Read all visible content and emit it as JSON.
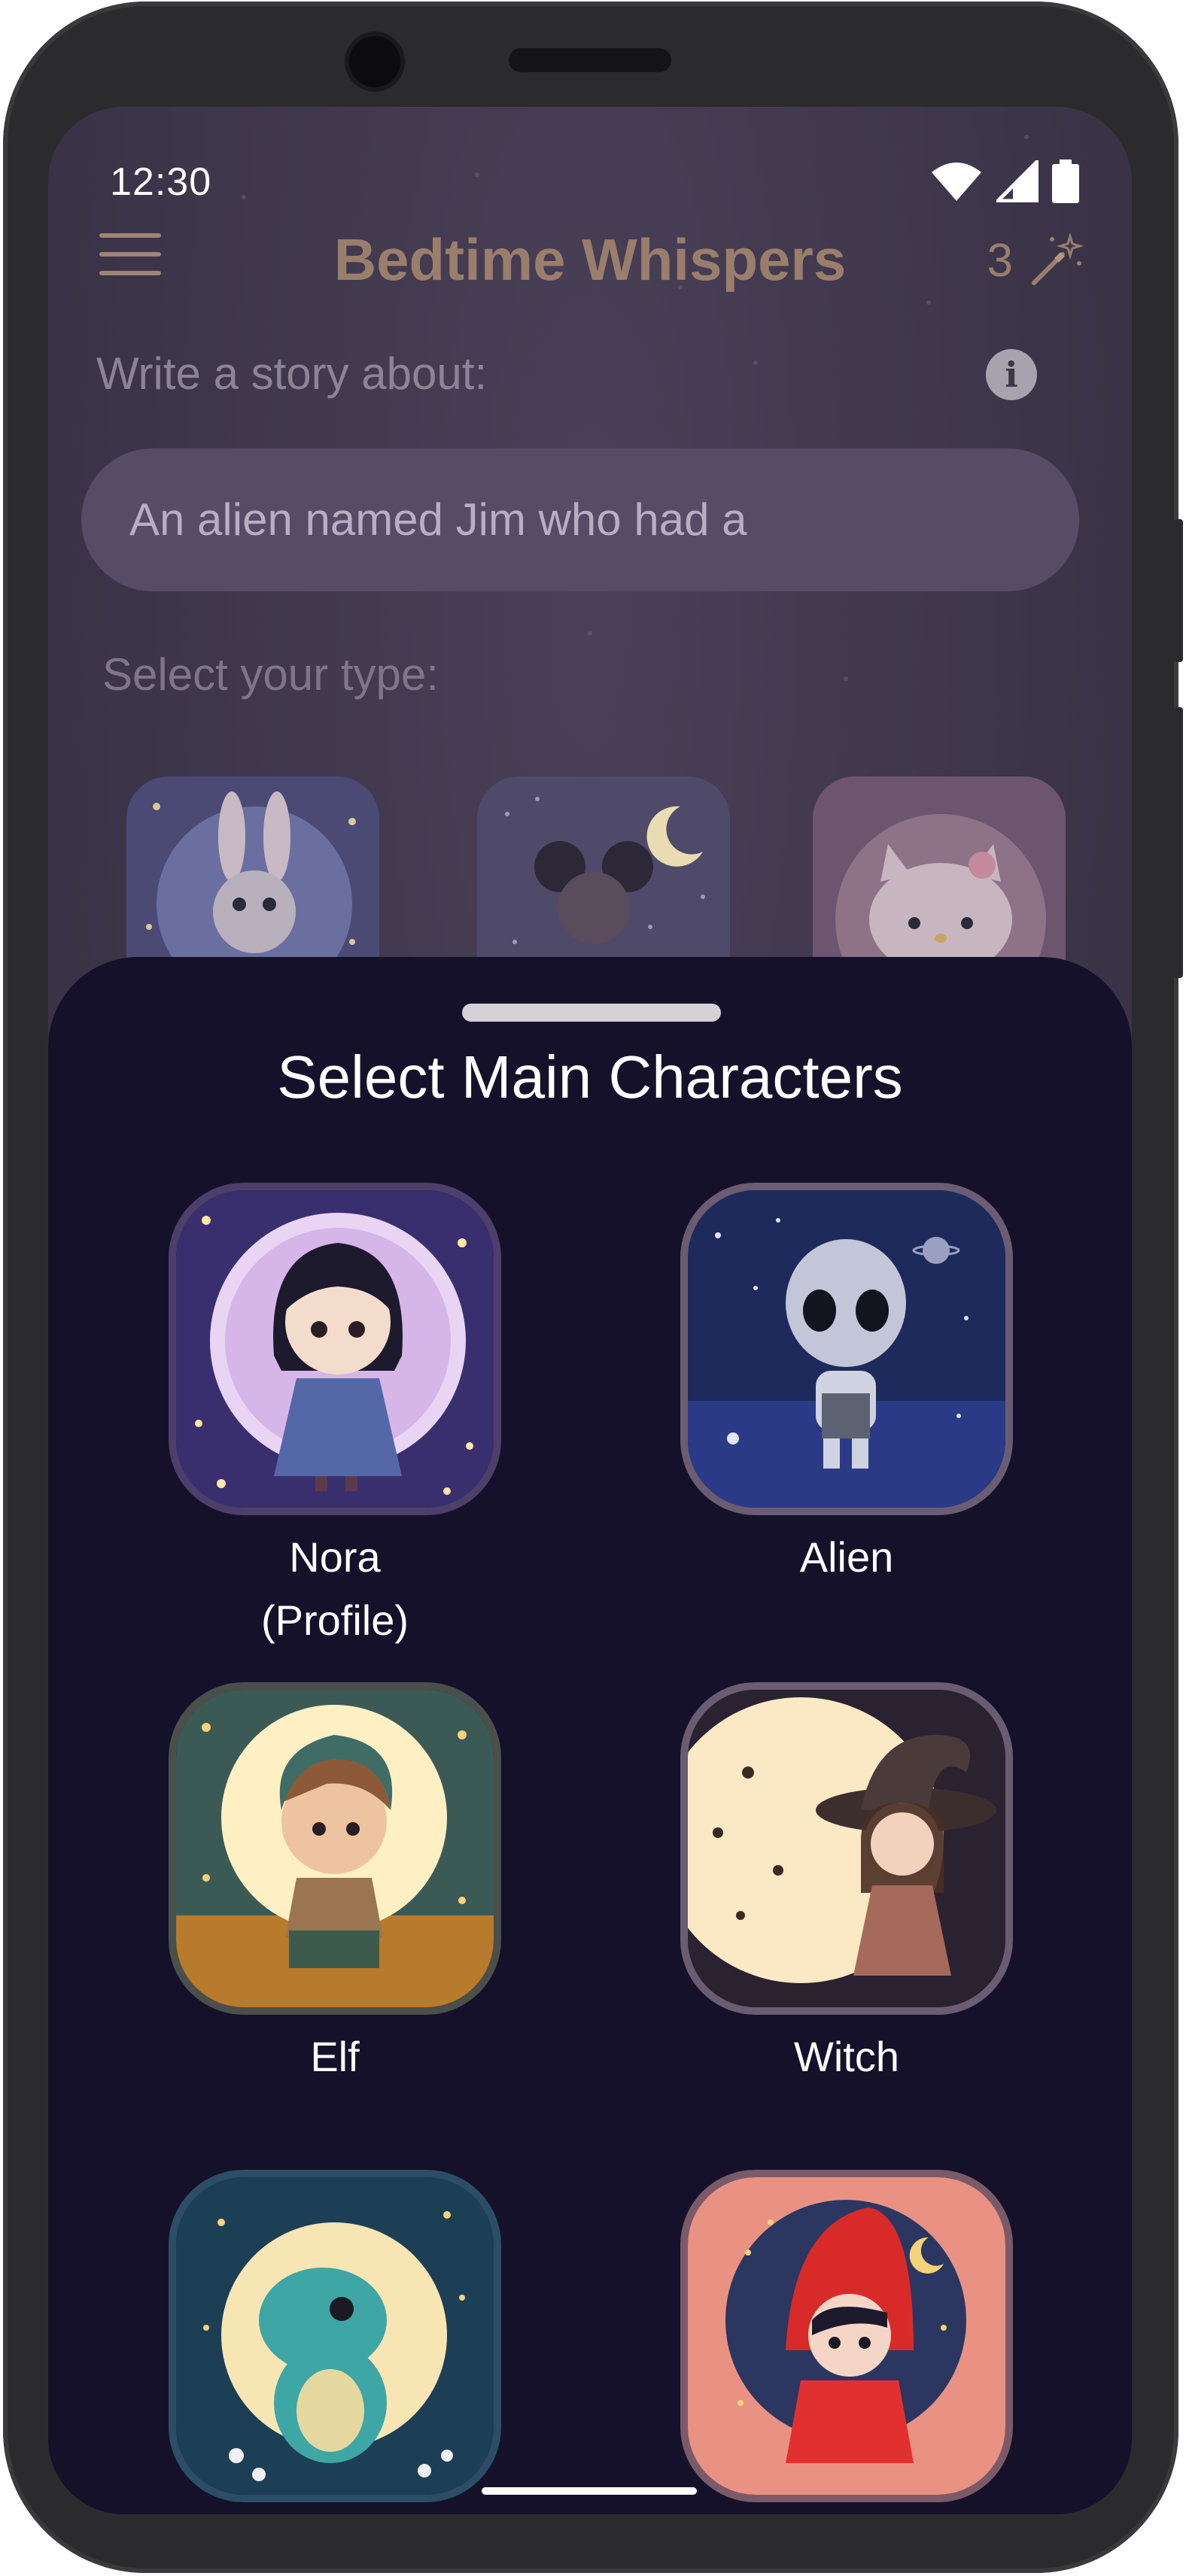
{
  "status_bar": {
    "time": "12:30"
  },
  "header": {
    "title": "Bedtime Whispers",
    "credits": "3"
  },
  "prompt": {
    "label": "Write a story about:",
    "value": "An alien named Jim who had a"
  },
  "type_section": {
    "label": "Select your type:"
  },
  "sheet": {
    "title": "Select Main Characters",
    "characters": [
      {
        "name": "Nora",
        "subtitle": "(Profile)"
      },
      {
        "name": "Alien"
      },
      {
        "name": "Elf"
      },
      {
        "name": "Witch"
      },
      {
        "name": "Dinosaur"
      },
      {
        "name": "Red Hood"
      }
    ]
  },
  "colors": {
    "background": "#3d3549",
    "sheet": "#15112a",
    "accent": "#9a7e6c",
    "card_border": "#6a5c72"
  },
  "icons": {
    "menu": "hamburger-icon",
    "credits": "magic-wand-icon",
    "info": "info-icon",
    "wifi": "wifi-icon",
    "signal": "signal-icon",
    "battery": "battery-icon"
  }
}
